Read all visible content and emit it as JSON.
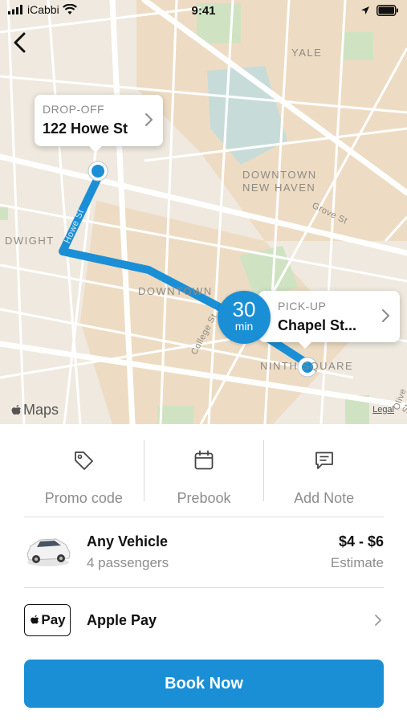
{
  "status_bar": {
    "carrier": "iCabbi",
    "time": "9:41"
  },
  "map": {
    "labels": {
      "yale": "YALE",
      "downtown_new_haven_1": "DOWNTOWN",
      "downtown_new_haven_2": "NEW HAVEN",
      "grove_st": "Grove St",
      "dwight": "DWIGHT",
      "howe_st": "Howe St",
      "downtown": "DOWNTOWN",
      "college_st": "College St",
      "ninth_square": "NINTH SQUARE",
      "olive_st": "Olive St"
    },
    "dropoff": {
      "label": "DROP-OFF",
      "address": "122 Howe St"
    },
    "pickup": {
      "label": "PICK-UP",
      "address": "Chapel St..."
    },
    "eta": {
      "value": "30",
      "unit": "min"
    },
    "attribution": "Maps",
    "legal": "Legal",
    "route_color": "#1a8fd6"
  },
  "actions": [
    {
      "label": "Promo code",
      "icon": "tag-icon"
    },
    {
      "label": "Prebook",
      "icon": "calendar-icon"
    },
    {
      "label": "Add Note",
      "icon": "message-icon"
    }
  ],
  "vehicle": {
    "name": "Any Vehicle",
    "capacity": "4 passengers",
    "price": "$4 - $6",
    "price_note": "Estimate",
    "icon": "car-icon"
  },
  "payment": {
    "logo_text": "Pay",
    "method": "Apple Pay",
    "icon": "apple-icon"
  },
  "book_button": {
    "label": "Book Now",
    "color": "#1a8fd6"
  }
}
